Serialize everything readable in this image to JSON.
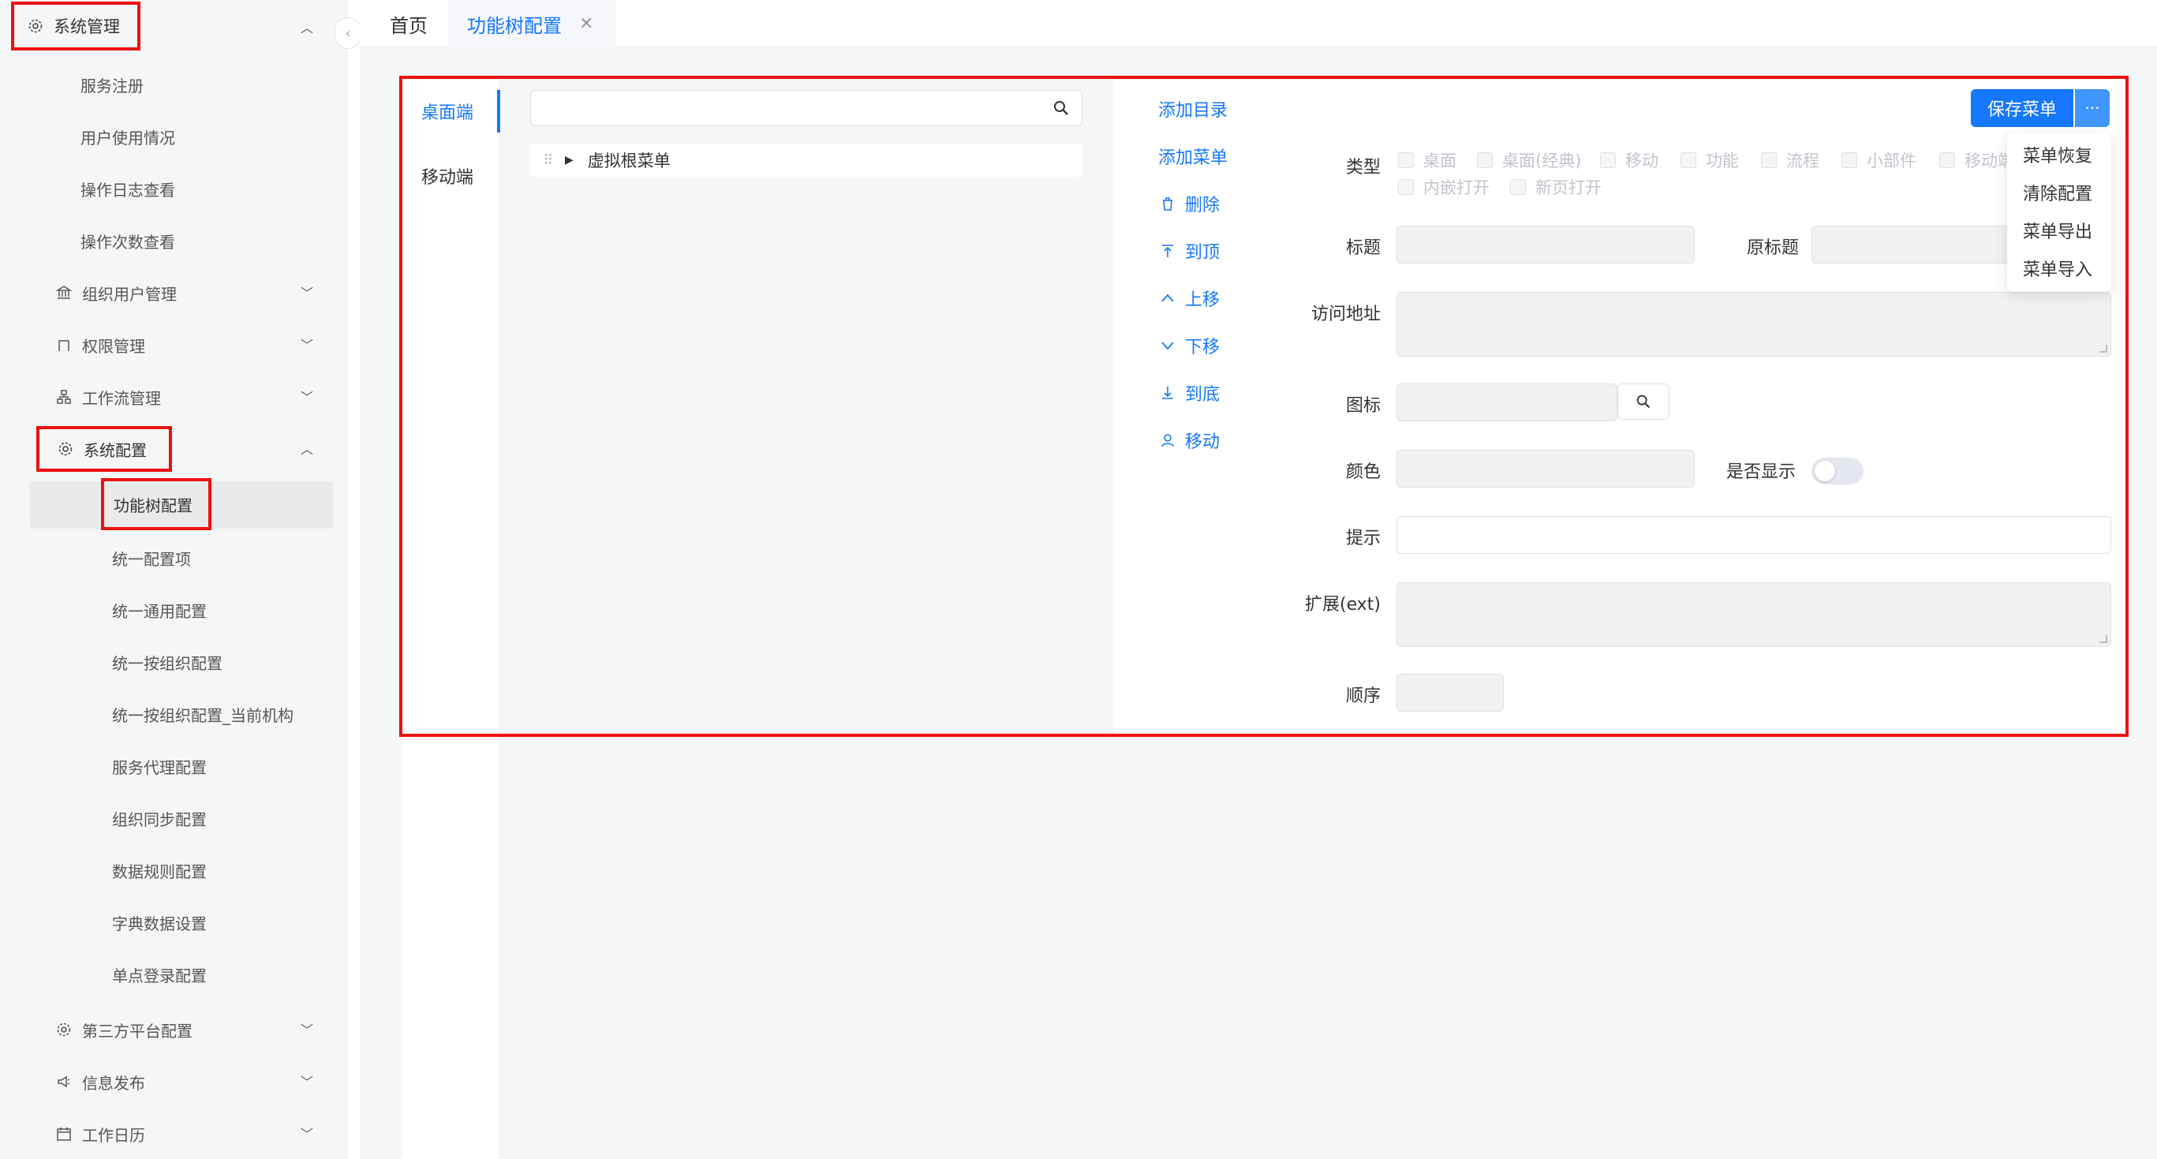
{
  "sidebar": {
    "group_system": "系统管理",
    "items_top": [
      "服务注册",
      "用户使用情况",
      "操作日志查看",
      "操作次数查看"
    ],
    "org_user": "组织用户管理",
    "permission": "权限管理",
    "workflow": "工作流管理",
    "sys_config": "系统配置",
    "config_items": [
      "功能树配置",
      "统一配置项",
      "统一通用配置",
      "统一按组织配置",
      "统一按组织配置_当前机构",
      "服务代理配置",
      "组织同步配置",
      "数据规则配置",
      "字典数据设置",
      "单点登录配置"
    ],
    "third_party": "第三方平台配置",
    "info_publish": "信息发布",
    "work_calendar": "工作日历"
  },
  "tabs": {
    "home": "首页",
    "active": "功能树配置"
  },
  "side_tabs": [
    "桌面端",
    "移动端"
  ],
  "tree": {
    "search_placeholder": "",
    "root_node": "虚拟根菜单"
  },
  "actions": [
    "添加目录",
    "添加菜单",
    "删除",
    "到顶",
    "上移",
    "下移",
    "到底",
    "移动"
  ],
  "form": {
    "type_label": "类型",
    "type_options": [
      "桌面",
      "桌面(经典)",
      "移动",
      "功能",
      "流程",
      "小部件",
      "移动端",
      "内嵌打开",
      "新页打开"
    ],
    "title_label": "标题",
    "orig_title_label": "原标题",
    "url_label": "访问地址",
    "icon_label": "图标",
    "color_label": "颜色",
    "show_label": "是否显示",
    "hint_label": "提示",
    "ext_label": "扩展(ext)",
    "order_label": "顺序"
  },
  "buttons": {
    "save": "保存菜单",
    "more": "···"
  },
  "dropdown": [
    "菜单恢复",
    "清除配置",
    "菜单导出",
    "菜单导入"
  ]
}
